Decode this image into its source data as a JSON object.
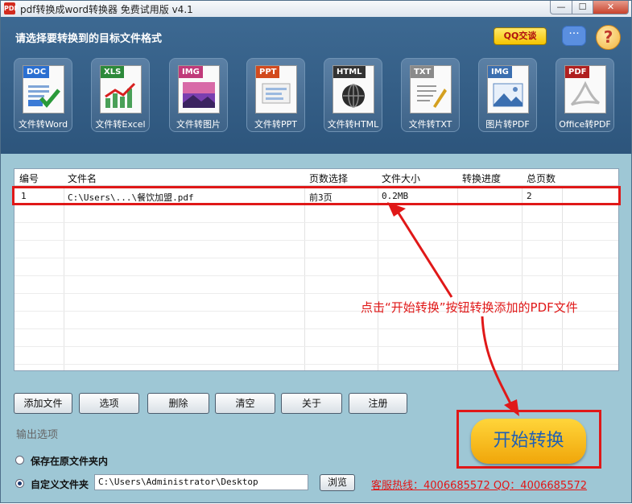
{
  "window": {
    "title": "pdf转换成word转换器 免费试用版 v4.1",
    "app_icon_text": "PDF",
    "min_label": "—",
    "max_label": "☐",
    "close_label": "✕"
  },
  "header": {
    "prompt": "请选择要转换到的目标文件格式",
    "qq_label": "QQ交谈",
    "help_label": "?"
  },
  "formats": [
    {
      "tag": "DOC",
      "label": "文件转Word",
      "tag_color": "#2a6fd1"
    },
    {
      "tag": "XLS",
      "label": "文件转Excel",
      "tag_color": "#2d8a3a"
    },
    {
      "tag": "IMG",
      "label": "文件转图片",
      "tag_color": "#c03a7a"
    },
    {
      "tag": "PPT",
      "label": "文件转PPT",
      "tag_color": "#d24a1e"
    },
    {
      "tag": "HTML",
      "label": "文件转HTML",
      "tag_color": "#333333"
    },
    {
      "tag": "TXT",
      "label": "文件转TXT",
      "tag_color": "#8a8a8a"
    },
    {
      "tag": "IMG",
      "label": "图片转PDF",
      "tag_color": "#3b6fb0"
    },
    {
      "tag": "PDF",
      "label": "Office转PDF",
      "tag_color": "#b02020"
    }
  ],
  "table": {
    "columns": [
      "编号",
      "文件名",
      "页数选择",
      "文件大小",
      "转换进度",
      "总页数"
    ],
    "rows": [
      {
        "num": "1",
        "filename": "C:\\Users\\...\\餐饮加盟.pdf",
        "pages": "前3页",
        "size": "0.2MB",
        "progress": "",
        "total": "2"
      }
    ]
  },
  "buttons": [
    "添加文件",
    "选项",
    "删除",
    "清空",
    "关于",
    "注册"
  ],
  "output": {
    "section_label": "输出选项",
    "option1": "保存在原文件夹内",
    "option2": "自定义文件夹",
    "selected": 2,
    "path": "C:\\Users\\Administrator\\Desktop",
    "browse_label": "浏览"
  },
  "hotline": "客服热线：4006685572 QQ：4006685572",
  "start_label": "开始转换",
  "annotation": "点击“开始转换”按钮转换添加的PDF文件",
  "colors": {
    "annotation": "#e01818",
    "header_bg": "#3d6992",
    "window_bg": "#9ec7d5",
    "start_text": "#1e5fb5"
  }
}
